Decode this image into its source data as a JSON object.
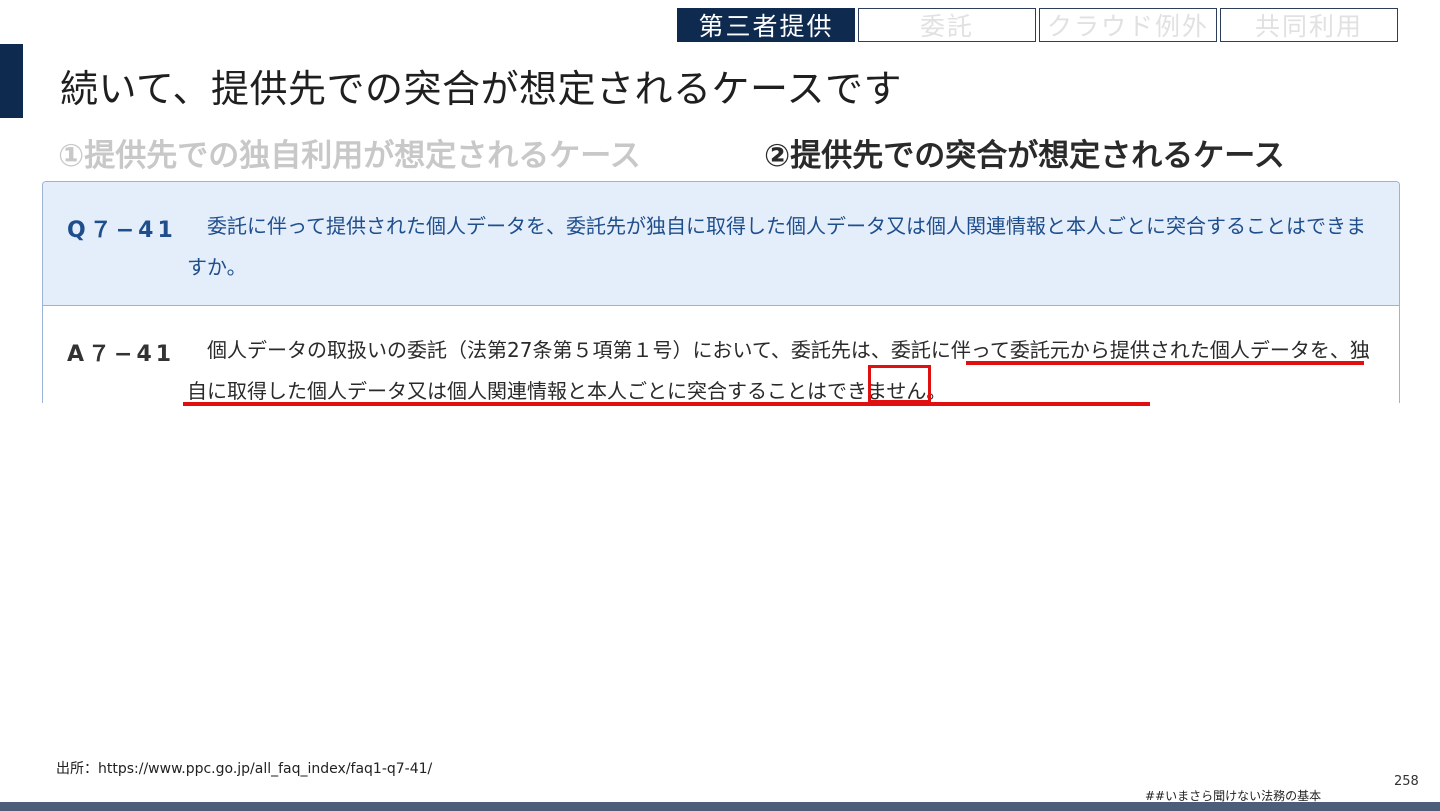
{
  "tabs": [
    {
      "label": "第三者提供",
      "active": true
    },
    {
      "label": "委託",
      "active": false
    },
    {
      "label": "クラウド例外",
      "active": false
    },
    {
      "label": "共同利用",
      "active": false
    }
  ],
  "title": "続いて、提供先での突合が想定されるケースです",
  "cases": {
    "case1": "①提供先での独自利用が想定されるケース",
    "case2": "②提供先での突合が想定されるケース"
  },
  "faq": {
    "q_label": "Q７−41",
    "q_text": "委託に伴って提供された個人データを、委託先が独自に取得した個人データ又は個人関連情報と本人ごとに突合することはできますか。",
    "a_label": "A７−41",
    "a_text": "個人データの取扱いの委託（法第27条第５項第１号）において、委託先は、委託に伴って委託元から提供された個人データを、独自に取得した個人データ又は個人関連情報と本人ごとに突合することはできません。"
  },
  "source": "出所：https://www.ppc.go.jp/all_faq_index/faq1-q7-41/",
  "page_number": "258",
  "footer_tag": "##いまさら聞けない法務の基本",
  "colors": {
    "navy": "#0f2a4f",
    "question_bg": "#e4eefb",
    "question_text": "#1f4e8c",
    "highlight_red": "#e01010"
  }
}
